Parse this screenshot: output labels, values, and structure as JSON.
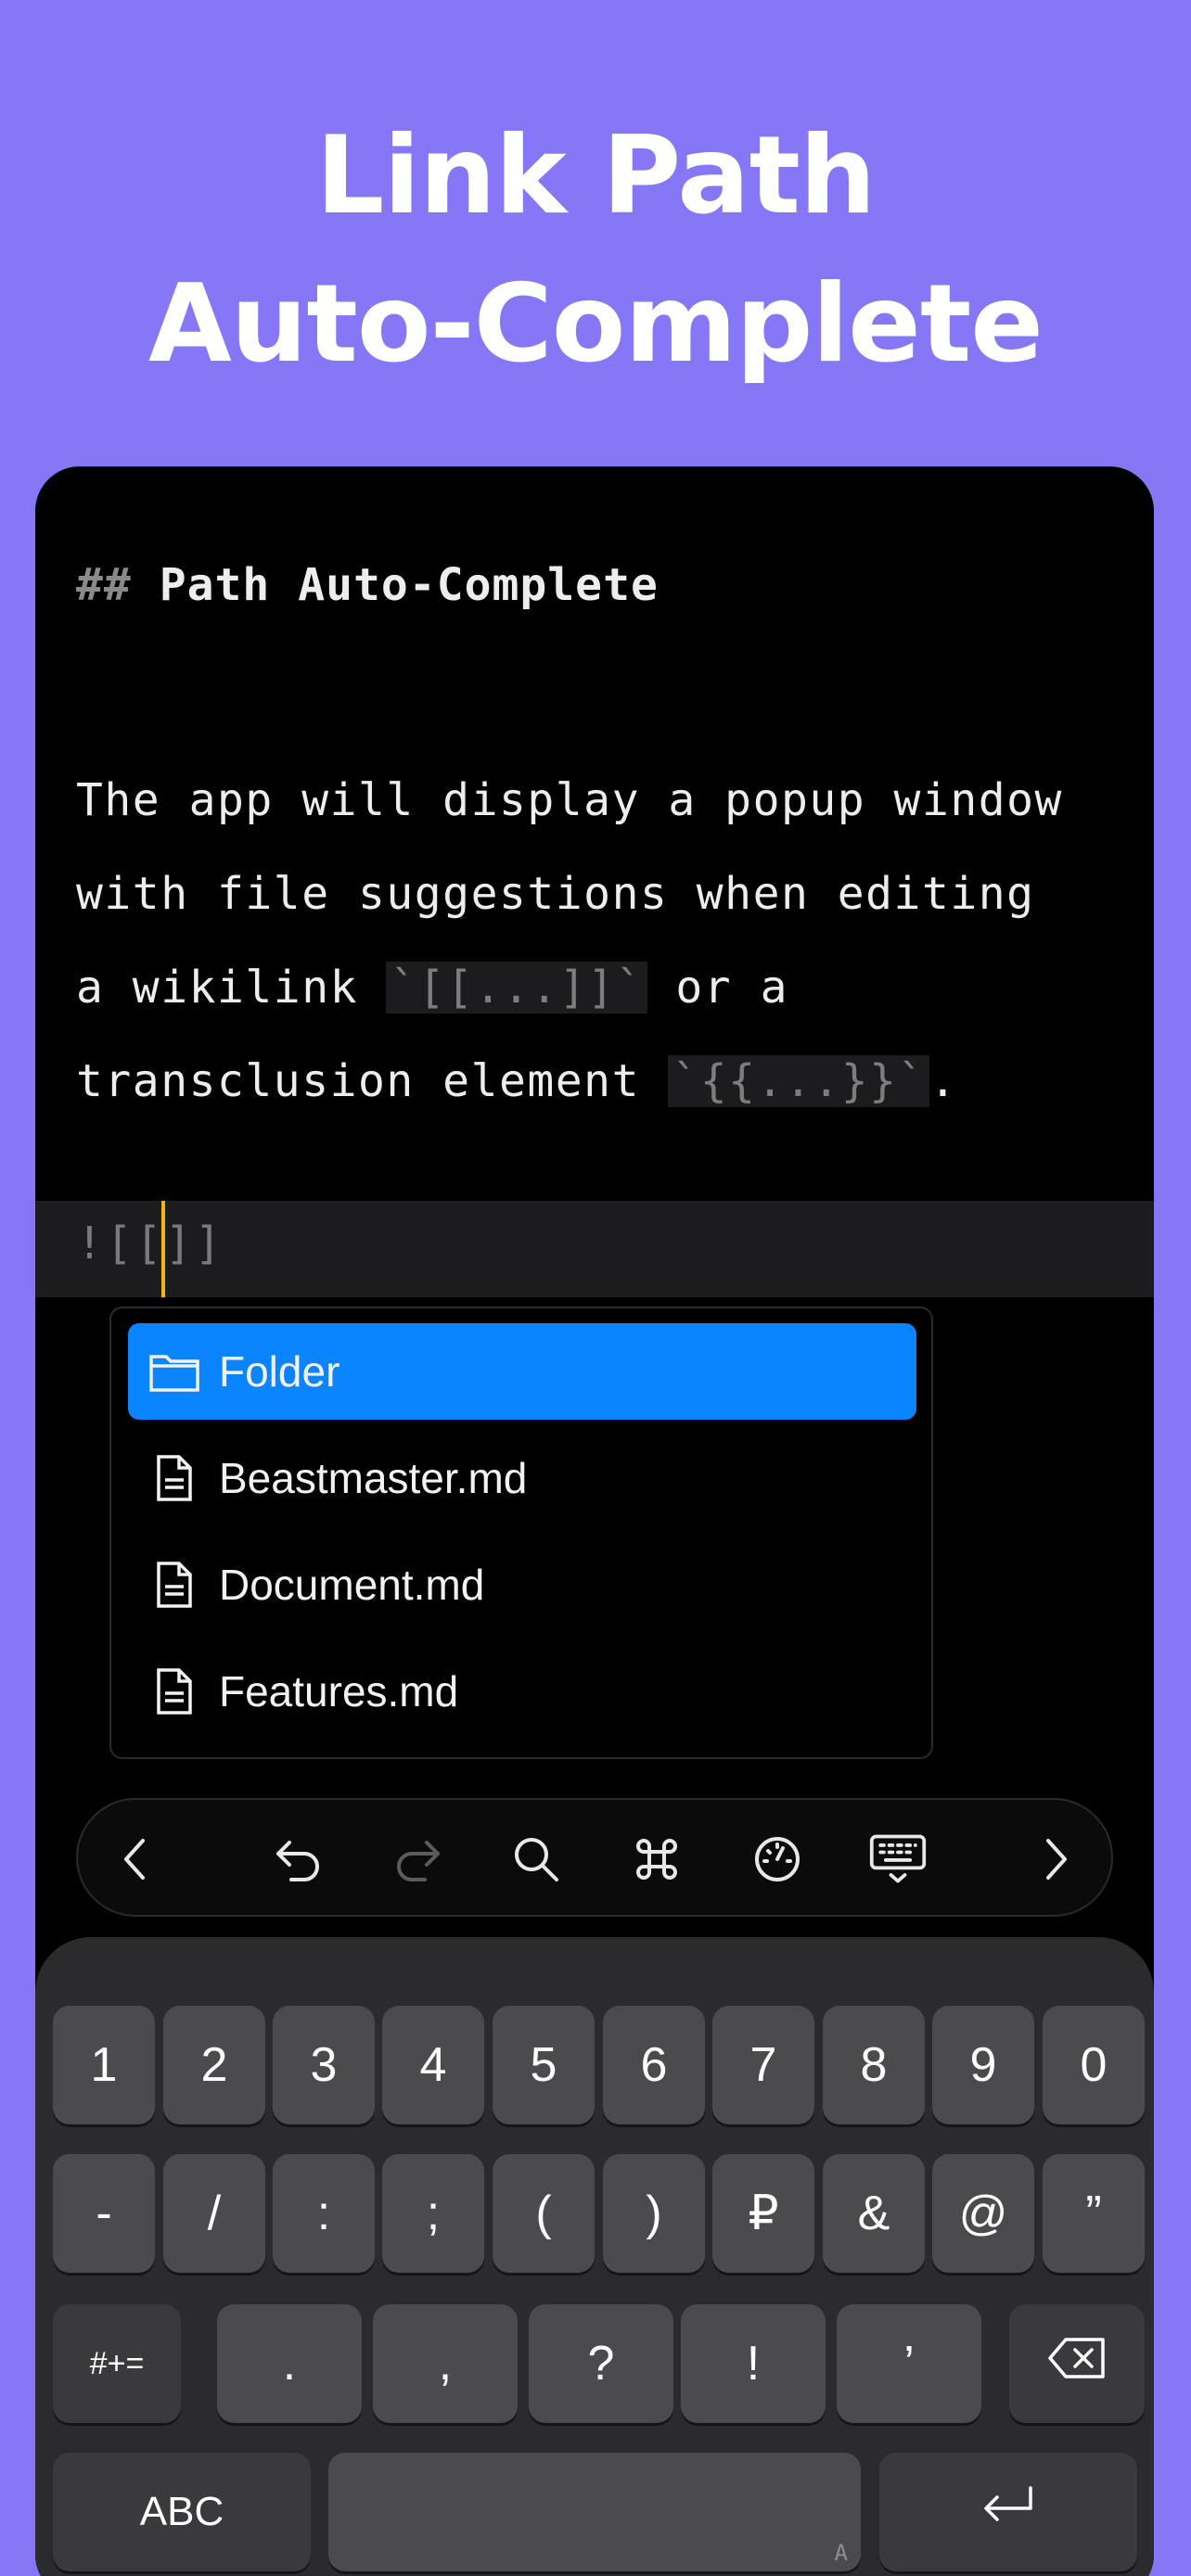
{
  "hero": {
    "line1": "Link Path",
    "line2": "Auto-Complete"
  },
  "editor": {
    "heading_marker": "##",
    "heading_text": "Path Auto-Complete",
    "para": {
      "l1": "The app will display a popup window",
      "l2": "with file suggestions when editing",
      "l3a": "a wikilink ",
      "l3code": "`[[...]]`",
      "l3b": " or a",
      "l4a": "transclusion element ",
      "l4code": "`{{...}}`",
      "l4b": "."
    },
    "current_line": "![[]]"
  },
  "popup": {
    "items": [
      {
        "label": "Folder",
        "icon": "folder-icon",
        "selected": true
      },
      {
        "label": "Beastmaster.md",
        "icon": "document-icon"
      },
      {
        "label": "Document.md",
        "icon": "document-icon"
      },
      {
        "label": "Features.md",
        "icon": "document-icon"
      }
    ]
  },
  "toolbar": {
    "icons": [
      "chevron-left-icon",
      "undo-icon",
      "redo-icon",
      "search-icon",
      "command-icon",
      "gauge-icon",
      "keyboard-dismiss-icon",
      "chevron-right-icon"
    ]
  },
  "keyboard": {
    "row1": [
      "1",
      "2",
      "3",
      "4",
      "5",
      "6",
      "7",
      "8",
      "9",
      "0"
    ],
    "row2": [
      "-",
      "/",
      ":",
      ";",
      "(",
      ")",
      "₽",
      "&",
      "@",
      "”"
    ],
    "row3": [
      "#+=",
      ".",
      ",",
      "?",
      "!",
      "’"
    ],
    "abc": "ABC",
    "space_hint": "A"
  },
  "colors": {
    "background": "#8577f6",
    "selection": "#0a84ff",
    "caret": "#f3b613"
  }
}
